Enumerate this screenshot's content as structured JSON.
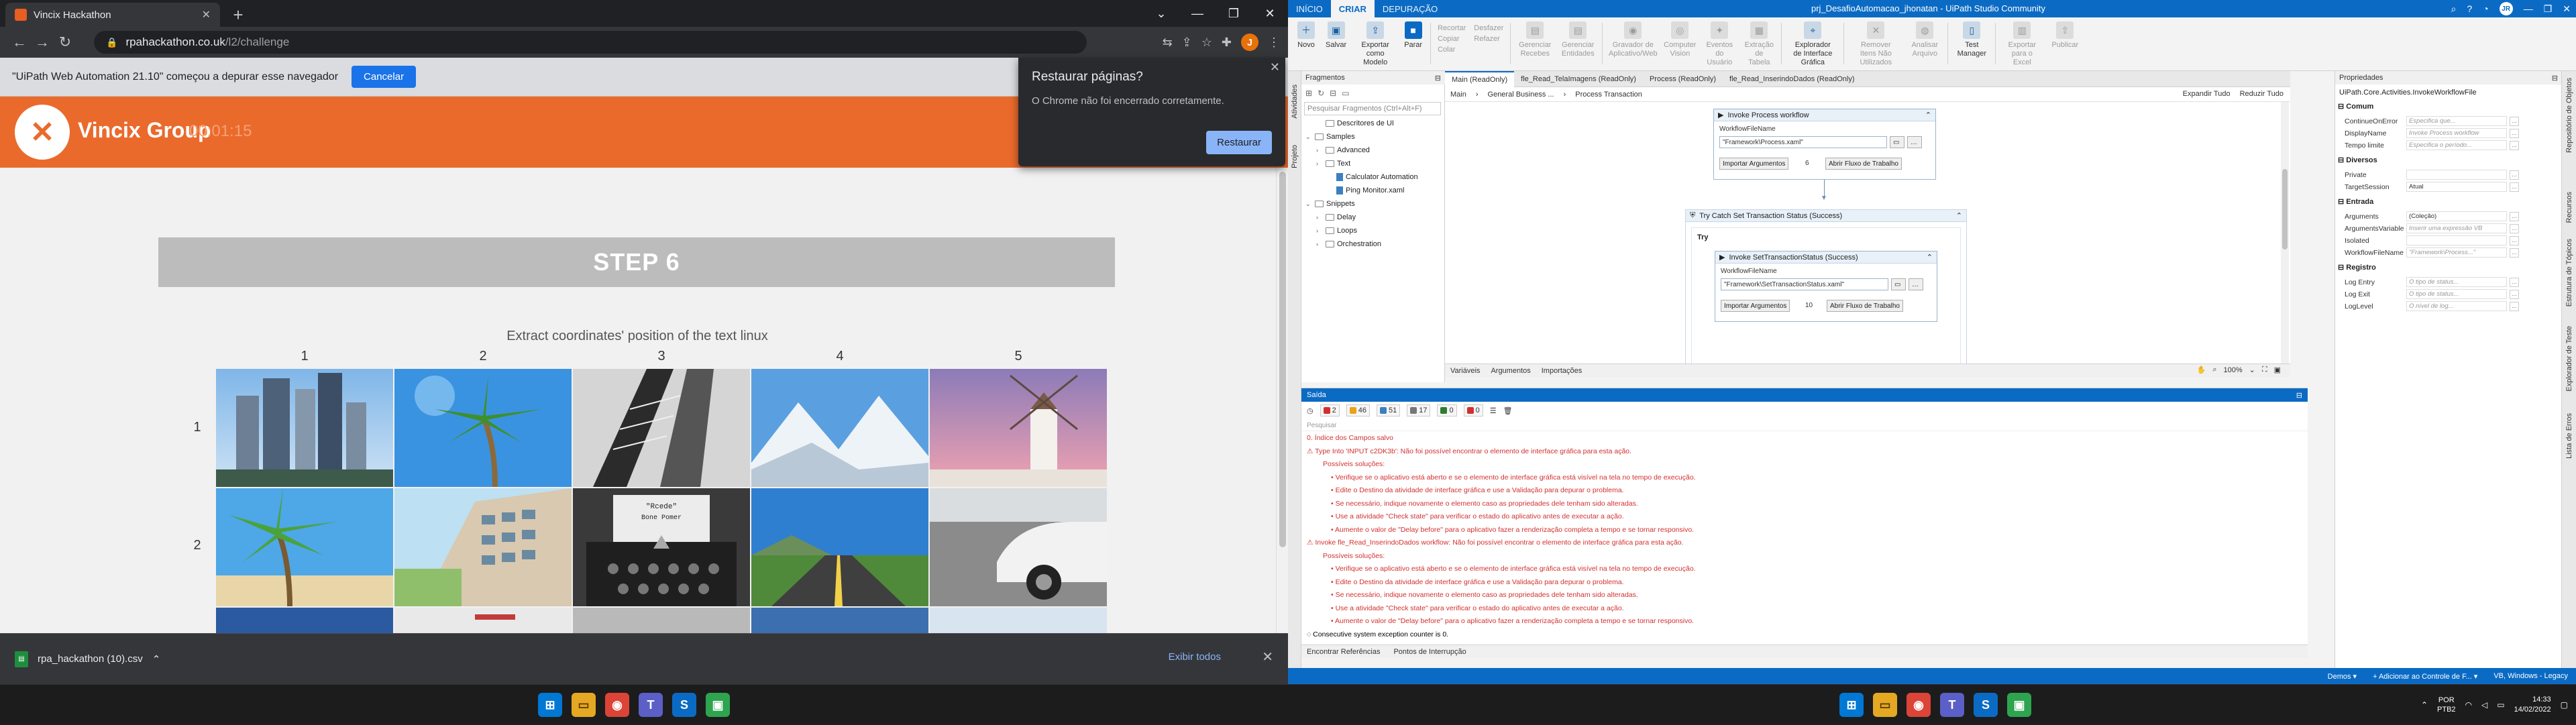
{
  "chrome": {
    "tab_title": "Vincix Hackathon",
    "url_host": "rpahackathon.co.uk",
    "url_path": "/l2/challenge",
    "debug_msg": "\"UiPath Web Automation 21.10\" começou a depurar esse navegador",
    "debug_cancel": "Cancelar",
    "restore": {
      "title": "Restaurar páginas?",
      "desc": "O Chrome não foi encerrado corretamente.",
      "button": "Restaurar"
    },
    "avatar": "J",
    "downloads": {
      "file": "rpa_hackathon (10).csv",
      "show_all": "Exibir todos"
    }
  },
  "site": {
    "brand": "Vincix Group",
    "timer": "00:01:15",
    "step": "STEP 6",
    "instruction": "Extract coordinates' position of the text linux",
    "col_headers": [
      "1",
      "2",
      "3",
      "4",
      "5"
    ],
    "row_headers": [
      "1",
      "2"
    ],
    "typewriter_text": "\"Rcede\"\nBone Pomer"
  },
  "studio": {
    "tabs": [
      "INÍCIO",
      "CRIAR",
      "DEPURAÇÃO"
    ],
    "title": "prj_DesafioAutomacao_jhonatan - UiPath Studio Community",
    "user": "JR",
    "ribbon": [
      {
        "label": "Novo",
        "state": "normal",
        "icon": "＋"
      },
      {
        "label": "Salvar",
        "state": "normal",
        "icon": "▣"
      },
      {
        "label": "Exportar como Modelo",
        "state": "normal",
        "icon": "⇪"
      },
      {
        "label": "Parar",
        "state": "on",
        "icon": "■"
      }
    ],
    "ribbon_small": [
      "Recortar",
      "Copiar",
      "Colar",
      "Desfazer",
      "Refazer"
    ],
    "ribbon2": [
      {
        "label": "Gerenciar Recebes",
        "state": "dim",
        "icon": "▤"
      },
      {
        "label": "Gerenciar Entidades",
        "state": "dim",
        "icon": "▤"
      },
      {
        "label": "Gravador de Aplicativo/Web",
        "state": "dim",
        "icon": "◉"
      },
      {
        "label": "Computer Vision",
        "state": "dim",
        "icon": "◎"
      },
      {
        "label": "Eventos do Usuário",
        "state": "dim",
        "icon": "✦"
      },
      {
        "label": "Extração de Tabela",
        "state": "dim",
        "icon": "▦"
      },
      {
        "label": "Explorador de Interface Gráfica",
        "state": "normal",
        "icon": "⌖"
      },
      {
        "label": "Remover Itens Não Utilizados",
        "state": "dim",
        "icon": "✕"
      },
      {
        "label": "Analisar Arquivo",
        "state": "dim",
        "icon": "◍"
      },
      {
        "label": "Test Manager",
        "state": "normal",
        "icon": "▯"
      },
      {
        "label": "Exportar para o Excel",
        "state": "dim",
        "icon": "▥"
      },
      {
        "label": "Publicar",
        "state": "dim",
        "icon": "⇧"
      }
    ],
    "left_vtabs": [
      "Atividades",
      "Projeto"
    ],
    "fragments": {
      "title": "Fragmentos",
      "search": "Pesquisar Fragmentos (Ctrl+Alt+F)",
      "tree": [
        {
          "label": "Descritores de UI",
          "level": 1,
          "kind": "folder",
          "arrow": ""
        },
        {
          "label": "Samples",
          "level": 0,
          "kind": "folder",
          "arrow": "v"
        },
        {
          "label": "Advanced",
          "level": 1,
          "kind": "folder",
          "arrow": ">"
        },
        {
          "label": "Text",
          "level": 1,
          "kind": "folder",
          "arrow": ">"
        },
        {
          "label": "Calculator Automation",
          "level": 2,
          "kind": "file",
          "arrow": ""
        },
        {
          "label": "Ping Monitor.xaml",
          "level": 2,
          "kind": "file",
          "arrow": ""
        },
        {
          "label": "Snippets",
          "level": 0,
          "kind": "folder",
          "arrow": "v"
        },
        {
          "label": "Delay",
          "level": 1,
          "kind": "folder",
          "arrow": ">"
        },
        {
          "label": "Loops",
          "level": 1,
          "kind": "folder",
          "arrow": ">"
        },
        {
          "label": "Orchestration",
          "level": 1,
          "kind": "folder",
          "arrow": ">"
        }
      ]
    },
    "doc_tabs": [
      "Main (ReadOnly)",
      "fle_Read_TelaImagens (ReadOnly)",
      "Process (ReadOnly)",
      "fle_Read_InserindoDados (ReadOnly)"
    ],
    "breadcrumb": [
      "Main",
      "General Business ...",
      "Process Transaction"
    ],
    "expand_all": "Expandir Tudo",
    "collapse_all": "Reduzir Tudo",
    "canvas": {
      "invoke_process": {
        "title": "Invoke Process workflow",
        "file_label": "WorkflowFileName",
        "file_value": "\"Framework\\Process.xaml\"",
        "import_btn": "Importar Argumentos",
        "arg_count": "6",
        "open_btn": "Abrir Fluxo de Trabalho"
      },
      "try_catch": "Try Catch Set Transaction Status (Success)",
      "try_label": "Try",
      "invoke_set": {
        "title": "Invoke SetTransactionStatus (Success)",
        "file_label": "WorkflowFileName",
        "file_value": "\"Framework\\SetTransactionStatus.xaml\"",
        "import_btn": "Importar Argumentos",
        "arg_count": "10",
        "open_btn": "Abrir Fluxo de Trabalho"
      }
    },
    "designer_bottom": [
      "Variáveis",
      "Argumentos",
      "Importações"
    ],
    "zoom": "100%",
    "properties": {
      "title": "Propriedades",
      "class": "UiPath.Core.Activities.InvokeWorkflowFile",
      "categories": [
        {
          "name": "Comum",
          "rows": [
            {
              "name": "ContinueOnError",
              "value": "Especifica que..."
            },
            {
              "name": "DisplayName",
              "value": "Invoke Process workflow"
            },
            {
              "name": "Tempo limite",
              "value": "Especifica o período..."
            }
          ]
        },
        {
          "name": "Diversos",
          "rows": [
            {
              "name": "Private",
              "value": ""
            },
            {
              "name": "TargetSession",
              "value": "Atual"
            }
          ]
        },
        {
          "name": "Entrada",
          "rows": [
            {
              "name": "Arguments",
              "value": "(Coleção)"
            },
            {
              "name": "ArgumentsVariable",
              "value": "Inserir uma expressão VB"
            },
            {
              "name": "Isolated",
              "value": ""
            },
            {
              "name": "WorkflowFileName",
              "value": "\"Framework\\Process...\""
            }
          ]
        },
        {
          "name": "Registro",
          "rows": [
            {
              "name": "Log Entry",
              "value": "O tipo de status..."
            },
            {
              "name": "Log Exit",
              "value": "O tipo de status..."
            },
            {
              "name": "LogLevel",
              "value": "O nível de log..."
            }
          ]
        }
      ]
    },
    "right_vtabs": [
      "Repositório de Objetos",
      "Recursos",
      "Estrutura de Tópicos",
      "Explorador de Teste",
      "Lista de Erros"
    ],
    "output": {
      "title": "Saída",
      "filters": [
        {
          "count": "2",
          "color": "#d32f2f"
        },
        {
          "count": "46",
          "color": "#e8a317"
        },
        {
          "count": "51",
          "color": "#3c7fc1"
        },
        {
          "count": "17",
          "color": "#777777"
        },
        {
          "count": "0",
          "color": "#2e7d32"
        },
        {
          "count": "0",
          "color": "#d32f2f"
        }
      ],
      "search": "Pesquisar",
      "lines": [
        {
          "text": "0. Índice dos Campos salvo",
          "cls": "err"
        },
        {
          "text": "⚠ Type Into 'INPUT c2DK3b': Não foi possível encontrar o elemento de interface gráfica para esta ação.",
          "cls": "err"
        },
        {
          "text": "Possíveis soluções:",
          "cls": "err sub"
        },
        {
          "text": "• Verifique se o aplicativo está aberto e se o elemento de interface gráfica está visível na tela no tempo de execução.",
          "cls": "err bul"
        },
        {
          "text": "• Edite o Destino da atividade de interface gráfica e use a Validação para depurar o problema.",
          "cls": "err bul"
        },
        {
          "text": "• Se necessário, indique novamente o elemento caso as propriedades dele tenham sido alteradas.",
          "cls": "err bul"
        },
        {
          "text": "• Use a atividade \"Check state\" para verificar o estado do aplicativo antes de executar a ação.",
          "cls": "err bul"
        },
        {
          "text": "• Aumente o valor de \"Delay before\" para o aplicativo fazer a renderização completa a tempo e se tornar responsivo.",
          "cls": "err bul"
        },
        {
          "text": "⚠ Invoke fle_Read_InserindoDados workflow: Não foi possível encontrar o elemento de interface gráfica para esta ação.",
          "cls": "err"
        },
        {
          "text": "Possíveis soluções:",
          "cls": "err sub"
        },
        {
          "text": "• Verifique se o aplicativo está aberto e se o elemento de interface gráfica está visível na tela no tempo de execução.",
          "cls": "err bul"
        },
        {
          "text": "• Edite o Destino da atividade de interface gráfica e use a Validação para depurar o problema.",
          "cls": "err bul"
        },
        {
          "text": "• Se necessário, indique novamente o elemento caso as propriedades dele tenham sido alteradas.",
          "cls": "err bul"
        },
        {
          "text": "• Use a atividade \"Check state\" para verificar o estado do aplicativo antes de executar a ação.",
          "cls": "err bul"
        },
        {
          "text": "• Aumente o valor de \"Delay before\" para o aplicativo fazer a renderização completa a tempo e se tornar responsivo.",
          "cls": "err bul"
        },
        {
          "text": "◌ Consecutive system exception counter is 0.",
          "cls": ""
        }
      ],
      "footer": [
        "Encontrar Referências",
        "Pontos de Interrupção"
      ]
    },
    "status_right": [
      "Demos ▾",
      "+ Adicionar ao Controle de F... ▾",
      "VB, Windows - Legacy"
    ]
  },
  "taskbar": {
    "lang": "POR",
    "lang2": "PTB2",
    "time": "14:33",
    "date": "14/02/2022"
  }
}
